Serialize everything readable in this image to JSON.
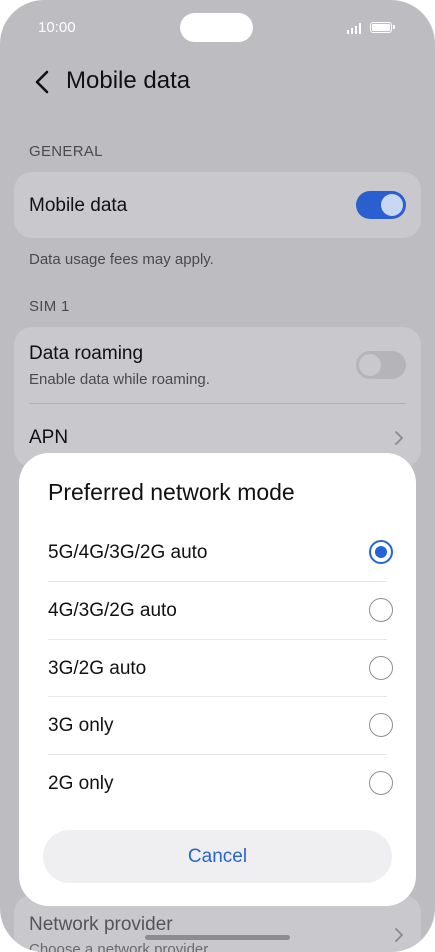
{
  "status_bar": {
    "time": "10:00"
  },
  "header": {
    "title": "Mobile data"
  },
  "general": {
    "section_label": "GENERAL",
    "mobile_data_label": "Mobile data",
    "mobile_data_on": true,
    "note": "Data usage fees may apply."
  },
  "sim1": {
    "section_label": "SIM 1",
    "roaming_label": "Data roaming",
    "roaming_sub": "Enable data while roaming.",
    "roaming_on": false,
    "apn_label": "APN"
  },
  "network_provider": {
    "label": "Network provider",
    "sub": "Choose a network provider"
  },
  "dialog": {
    "title": "Preferred network mode",
    "options": [
      {
        "label": "5G/4G/3G/2G auto",
        "selected": true
      },
      {
        "label": "4G/3G/2G auto",
        "selected": false
      },
      {
        "label": "3G/2G auto",
        "selected": false
      },
      {
        "label": "3G only",
        "selected": false
      },
      {
        "label": "2G only",
        "selected": false
      }
    ],
    "cancel_label": "Cancel"
  },
  "colors": {
    "accent": "#2563d9",
    "scrim_background": "#bdbcc1",
    "card": "#c9c8cd",
    "dialog": "#ffffff"
  },
  "icons": {
    "back": "chevron-left-icon",
    "apn_arrow": "chevron-right-icon",
    "signal": "signal-icon",
    "battery": "battery-icon"
  }
}
